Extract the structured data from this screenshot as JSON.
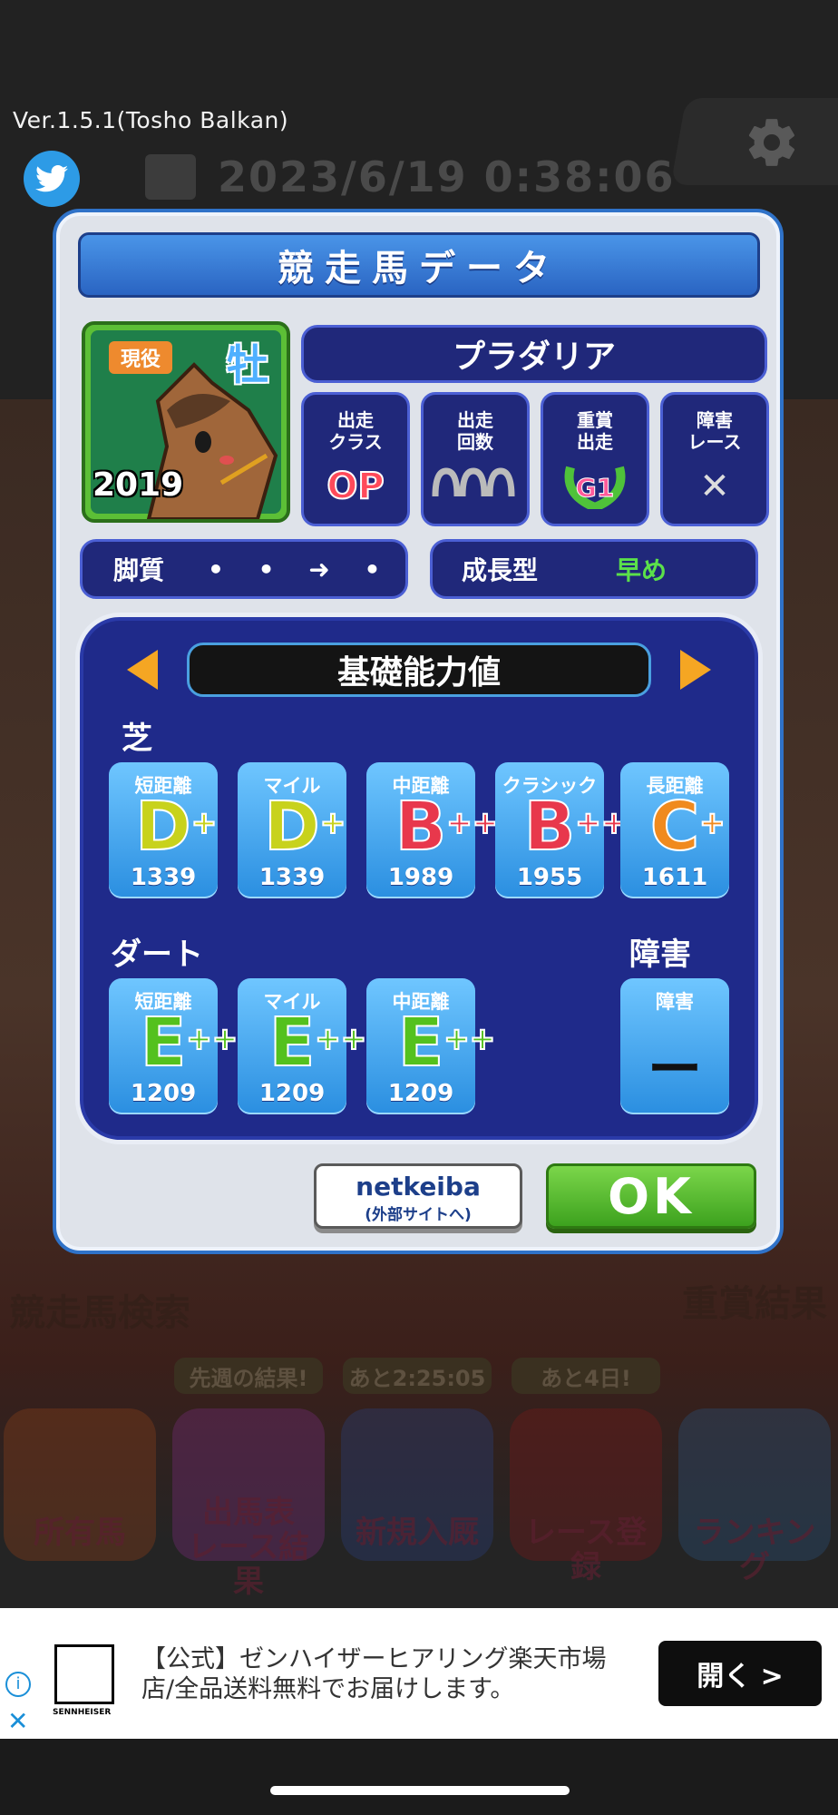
{
  "status": {
    "version": "Ver.1.5.1(Tosho Balkan)",
    "datetime": "2023/6/19 0:38:06"
  },
  "icons": {
    "twitter": "twitter-icon",
    "settings": "gear-icon",
    "calendar": "calendar-icon",
    "info": "info-icon",
    "close": "close-icon"
  },
  "background": {
    "search_label": "競走馬検索",
    "results_label": "重賞結果",
    "pills": [
      "先週の結果!",
      "あと2:25:05",
      "あと4日!"
    ],
    "menu": [
      "所有馬",
      "出馬表\nレース結果",
      "新規入厩",
      "レース登録",
      "ランキング"
    ]
  },
  "modal": {
    "title": "競走馬データ",
    "horse": {
      "status_badge": "現役",
      "sex": "牡",
      "year": "2019",
      "name": "プラダリア"
    },
    "stats": [
      {
        "label": "出走\nクラス",
        "value": "OP"
      },
      {
        "label": "出走\n回数",
        "value": "icon"
      },
      {
        "label": "重賞\n出走",
        "value": "G1"
      },
      {
        "label": "障害\nレース",
        "value": "✕"
      }
    ],
    "running_style": {
      "label": "脚質",
      "dots": "• • ➜ •"
    },
    "growth": {
      "label": "成長型",
      "value": "早め"
    },
    "panel": {
      "title": "基礎能力値",
      "turf_label": "芝",
      "turf": [
        {
          "label": "短距離",
          "grade": "D",
          "plus": "+",
          "value": "1339",
          "color": "#c8d21c"
        },
        {
          "label": "マイル",
          "grade": "D",
          "plus": "+",
          "value": "1339",
          "color": "#c8d21c"
        },
        {
          "label": "中距離",
          "grade": "B",
          "plus": "++",
          "value": "1989",
          "color": "#e8384c"
        },
        {
          "label": "クラシック",
          "grade": "B",
          "plus": "++",
          "value": "1955",
          "color": "#e8384c"
        },
        {
          "label": "長距離",
          "grade": "C",
          "plus": "+",
          "value": "1611",
          "color": "#f08a1e"
        }
      ],
      "dirt_label": "ダート",
      "dirt": [
        {
          "label": "短距離",
          "grade": "E",
          "plus": "++",
          "value": "1209",
          "color": "#54c11e"
        },
        {
          "label": "マイル",
          "grade": "E",
          "plus": "++",
          "value": "1209",
          "color": "#54c11e"
        },
        {
          "label": "中距離",
          "grade": "E",
          "plus": "++",
          "value": "1209",
          "color": "#54c11e"
        }
      ],
      "obstacle_label": "障害",
      "obstacle": {
        "label": "障害",
        "value": "ー"
      }
    },
    "buttons": {
      "netkeiba": "netkeiba",
      "netkeiba_sub": "(外部サイトへ)",
      "ok": "OK"
    }
  },
  "ad": {
    "brand": "SENNHEISER",
    "text": "【公式】ゼンハイザーヒアリング楽天市場店/全品送料無料でお届けします。",
    "button": "開く >"
  }
}
